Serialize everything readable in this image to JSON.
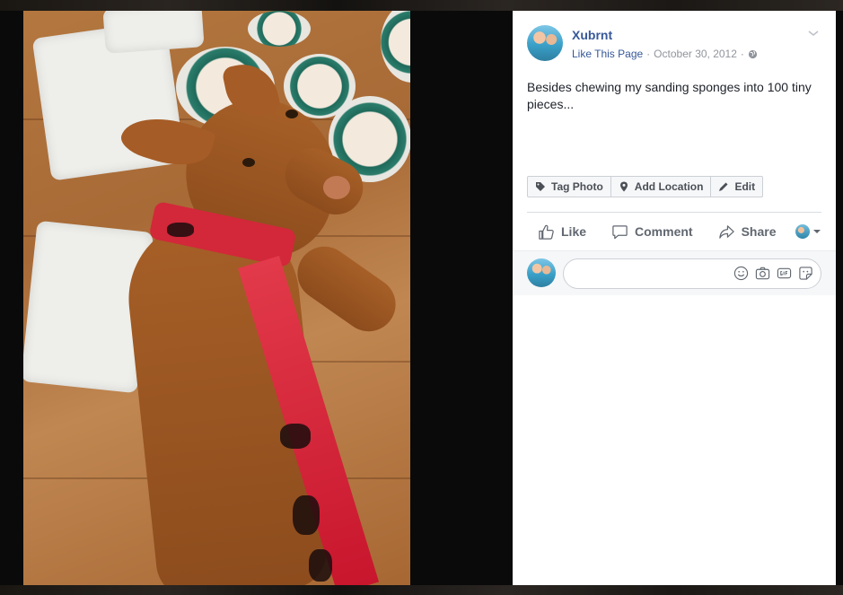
{
  "post": {
    "author": "Xubrnt",
    "like_page_link": "Like This Page",
    "separator": "·",
    "date": "October 30, 2012",
    "text": "Besides chewing my sanding sponges into 100 tiny pieces...",
    "photo_actions": [
      {
        "label": "Tag Photo",
        "icon": "tag-icon"
      },
      {
        "label": "Add Location",
        "icon": "location-pin-icon"
      },
      {
        "label": "Edit",
        "icon": "pencil-icon"
      }
    ],
    "ufi": {
      "like": "Like",
      "comment": "Comment",
      "share": "Share"
    },
    "comment_input": {
      "placeholder": "",
      "tools": [
        "emoji-icon",
        "camera-icon",
        "gif-icon",
        "sticker-icon"
      ]
    }
  },
  "colors": {
    "link": "#365899",
    "meta": "#90949c",
    "text": "#1d2129",
    "ufi_text": "#616770",
    "lightbox_bg": "#0a0a0a"
  }
}
